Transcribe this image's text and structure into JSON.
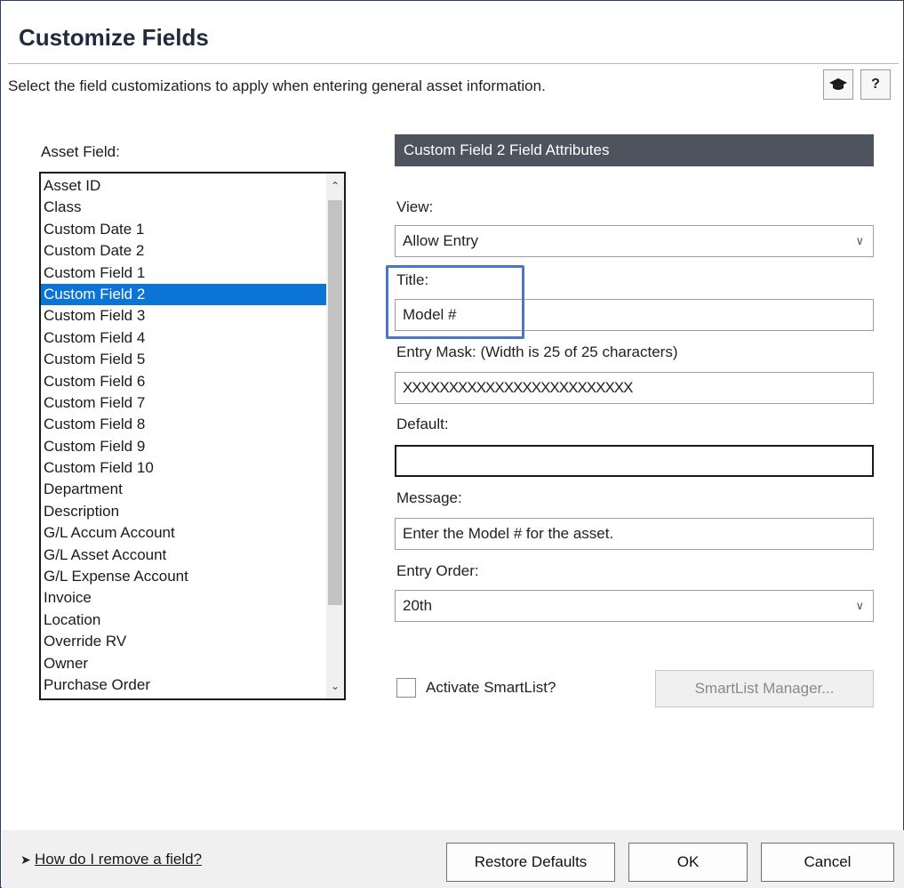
{
  "dialog": {
    "title": "Customize Fields",
    "subtitle": "Select the field customizations to apply when entering general asset information.",
    "help_icon_cap": "graduation-cap-icon",
    "help_icon_question": "?"
  },
  "asset_list": {
    "label": "Asset Field:",
    "selected_index": 5,
    "items": [
      "Asset ID",
      "Class",
      "Custom Date 1",
      "Custom Date 2",
      "Custom Field  1",
      "Custom Field  2",
      "Custom Field  3",
      "Custom Field  4",
      "Custom Field  5",
      "Custom Field  6",
      "Custom Field  7",
      "Custom Field  8",
      "Custom Field  9",
      "Custom Field 10",
      "Department",
      "Description",
      "G/L Accum Account",
      "G/L Asset Account",
      "G/L Expense Account",
      "Invoice",
      "Location",
      "Override RV",
      "Owner",
      "Purchase Order"
    ]
  },
  "attributes": {
    "header": "Custom Field  2  Field  Attributes",
    "view_label": "View:",
    "view_value": "Allow Entry",
    "title_label": "Title:",
    "title_value": "Model #",
    "mask_label": "Entry Mask: (Width is 25 of 25 characters)",
    "mask_value": "XXXXXXXXXXXXXXXXXXXXXXXXX",
    "default_label": "Default:",
    "default_value": "",
    "message_label": "Message:",
    "message_value": "Enter the Model # for the asset.",
    "order_label": "Entry Order:",
    "order_value": "20th",
    "smartlist_checkbox_label": "Activate SmartList?",
    "smartlist_checked": false,
    "smartlist_button": "SmartList Manager..."
  },
  "footer": {
    "help_link": "How do I remove a field?",
    "restore_button": "Restore Defaults",
    "ok_button": "OK",
    "cancel_button": "Cancel"
  },
  "colors": {
    "selection": "#0c74d4",
    "header_bg": "#4d545e",
    "highlight_box": "#4a78c4"
  }
}
